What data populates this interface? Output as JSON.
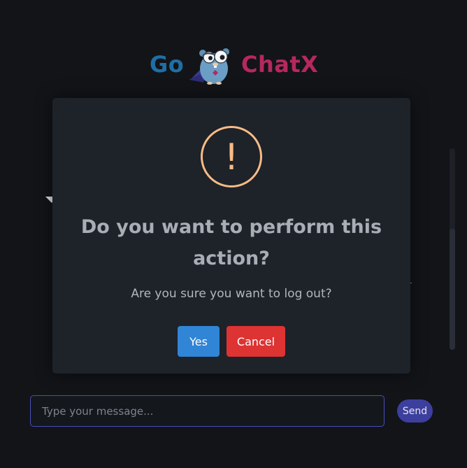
{
  "header": {
    "logo_left": "Go",
    "logo_right": "ChatX",
    "logo_left_color": "#1f6fa5",
    "logo_right_color": "#b5285f",
    "mascot_icon": "gopher-mascot-icon"
  },
  "dialog": {
    "icon": "warning-icon",
    "icon_glyph": "!",
    "icon_color": "#f8bb86",
    "title": "Do you want to perform this action?",
    "text": "Are you sure you want to log out?",
    "confirm_label": "Yes",
    "cancel_label": "Cancel",
    "confirm_color": "#3085d6",
    "cancel_color": "#dd3333"
  },
  "composer": {
    "placeholder": "Type your message...",
    "value": "",
    "send_label": "Send"
  }
}
